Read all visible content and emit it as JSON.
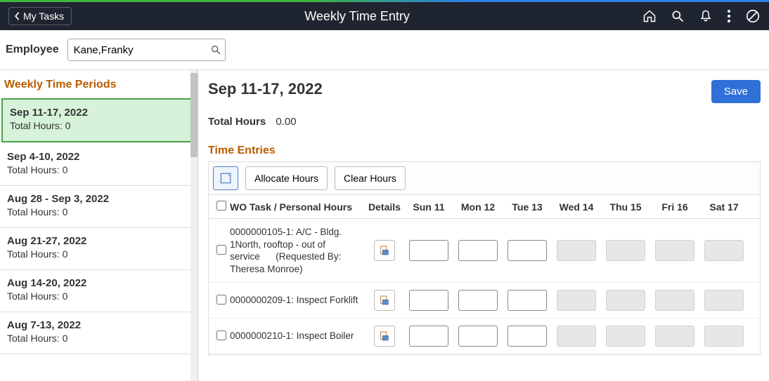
{
  "header": {
    "back_label": "My Tasks",
    "title": "Weekly Time Entry"
  },
  "employee": {
    "label": "Employee",
    "value": "Kane,Franky"
  },
  "sidebar": {
    "title": "Weekly Time Periods",
    "periods": [
      {
        "range": "Sep 11-17, 2022",
        "total": "Total Hours: 0",
        "selected": true
      },
      {
        "range": "Sep 4-10, 2022",
        "total": "Total Hours: 0"
      },
      {
        "range": "Aug 28 - Sep 3, 2022",
        "total": "Total Hours: 0"
      },
      {
        "range": "Aug 21-27, 2022",
        "total": "Total Hours: 0"
      },
      {
        "range": "Aug 14-20, 2022",
        "total": "Total Hours: 0"
      },
      {
        "range": "Aug 7-13, 2022",
        "total": "Total Hours: 0"
      }
    ]
  },
  "main": {
    "range_title": "Sep 11-17, 2022",
    "save_label": "Save",
    "total_label": "Total Hours",
    "total_value": "0.00",
    "entries_title": "Time Entries",
    "toolbar": {
      "allocate": "Allocate Hours",
      "clear": "Clear Hours"
    },
    "columns": {
      "task": "WO Task / Personal Hours",
      "details": "Details",
      "d0": "Sun 11",
      "d1": "Mon 12",
      "d2": "Tue 13",
      "d3": "Wed 14",
      "d4": "Thu 15",
      "d5": "Fri 16",
      "d6": "Sat 17"
    },
    "rows": [
      {
        "task": "0000000105-1: A/C - Bldg. 1North, rooftop - out of service      (Requested By: Theresa Monroe)"
      },
      {
        "task": "0000000209-1: Inspect Forklift"
      },
      {
        "task": "0000000210-1: Inspect Boiler"
      }
    ]
  }
}
